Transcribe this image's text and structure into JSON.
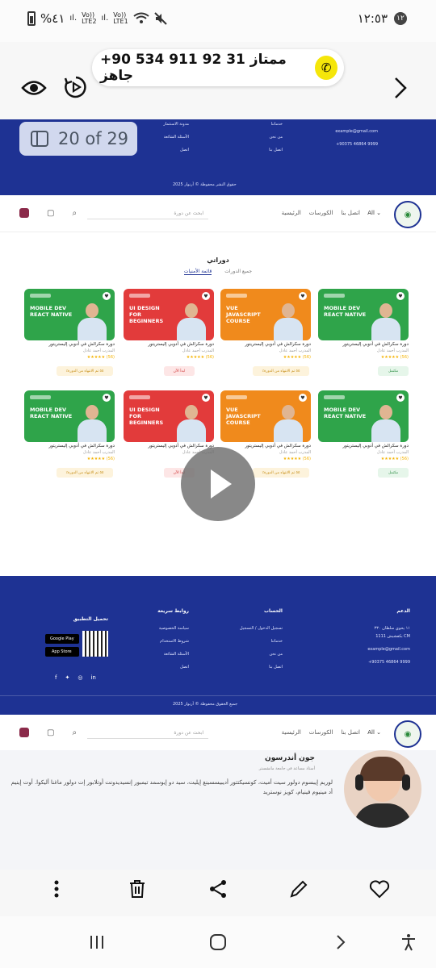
{
  "status_bar": {
    "battery": "%٤١",
    "net1": "Vo))\nLTE2",
    "net2": "Vo))\nLTE1",
    "time": "١٢:٥٣",
    "notif_count": "١٢"
  },
  "viewer": {
    "contact_text": "+90 534 911 92 31 ممتاز جاهز",
    "page_counter": "20 of 29"
  },
  "site": {
    "nav": {
      "home": "الرئيسية",
      "courses": "الكورسات",
      "contact": "اتصل بنا",
      "lang": "All",
      "search_placeholder": "ابحث عن دورة"
    },
    "section_title": "دوراتي",
    "tabs": [
      "قائمة الأمنيات",
      "جميع الدورات"
    ],
    "cards": [
      {
        "thumb_title": "MOBILE DEV\nREACT NATIVE",
        "color": "#2fa44a",
        "title": "دورة سكرالش في أدوبي إليستريتور",
        "sub": "المدرب أحمد عادل",
        "stars": "★★★★★ (56)",
        "button": "مكتمل",
        "btn_bg": "#e6f6ea",
        "btn_fg": "#2f8f47"
      },
      {
        "thumb_title": "VUE JAVASCRIPT\nCOURSE",
        "color": "#f08a1c",
        "title": "دورة سكرالش في أدوبي إليستريتور",
        "sub": "المدرب أحمد عادل",
        "stars": "★★★★★ (56)",
        "button": "٪٥٥ تم الانتهاء من الدورة",
        "btn_bg": "#fdf3dc",
        "btn_fg": "#c48a10"
      },
      {
        "thumb_title": "UI DESIGN\nFOR BEGINNERS",
        "color": "#e23b3b",
        "title": "دورة سكرالش في أدوبي إليستريتور",
        "sub": "المدرب أحمد عادل",
        "stars": "★★★★★ (56)",
        "button": "ابدأ الآن",
        "btn_bg": "#fde6e6",
        "btn_fg": "#d03434"
      },
      {
        "thumb_title": "MOBILE DEV\nREACT NATIVE",
        "color": "#2fa44a",
        "title": "دورة سكرالش في أدوبي إليستريتور",
        "sub": "المدرب أحمد عادل",
        "stars": "★★★★★ (56)",
        "button": "٪٥٥ تم الانتهاء من الدورة",
        "btn_bg": "#fdf3dc",
        "btn_fg": "#c48a10"
      },
      {
        "thumb_title": "MOBILE DEV\nREACT NATIVE",
        "color": "#2fa44a",
        "title": "دورة سكرالش في أدوبي إليستريتور",
        "sub": "المدرب أحمد عادل",
        "stars": "★★★★★ (56)",
        "button": "مكتمل",
        "btn_bg": "#e6f6ea",
        "btn_fg": "#2f8f47"
      },
      {
        "thumb_title": "VUE JAVASCRIPT\nCOURSE",
        "color": "#f08a1c",
        "title": "دورة سكرالش في أدوبي إليستريتور",
        "sub": "المدرب أحمد عادل",
        "stars": "★★★★★ (56)",
        "button": "٪٥٥ تم الانتهاء من الدورة",
        "btn_bg": "#fdf3dc",
        "btn_fg": "#c48a10"
      },
      {
        "thumb_title": "UI DESIGN\nFOR BEGINNERS",
        "color": "#e23b3b",
        "title": "دورة سكرالش في أدوبي إليستريتور",
        "sub": "المدرب أحمد عادل",
        "stars": "",
        "button": "ابدأ الآن",
        "btn_bg": "#fde6e6",
        "btn_fg": "#d03434"
      },
      {
        "thumb_title": "MOBILE DEV\nREACT NATIVE",
        "color": "#2fa44a",
        "title": "دورة سكرالش في أدوبي إليستريتور",
        "sub": "المدرب أحمد عادل",
        "stars": "★★★★★ (56)",
        "button": "٪٥٥ تم الانتهاء من الدورة",
        "btn_bg": "#fdf3dc",
        "btn_fg": "#c48a10"
      }
    ],
    "footer": {
      "support_h": "الدعم",
      "support_lines": [
        "١١ يحوي سلطان ٣٣٠",
        "بكفشيش 1111 CM",
        "example@gmail.com",
        "+90375 46864 9999"
      ],
      "account_h": "الحساب",
      "account_links": [
        "تسجيل الدخول / التسجيل",
        "خدماتنا",
        "من نحن",
        "اتصل بنا"
      ],
      "quick_h": "روابط سريعة",
      "quick_links": [
        "سياسة الخصوصية",
        "شروط الاستخدام",
        "الأسئلة الشائعة",
        "اتصل"
      ],
      "app_h": "تحميل التطبيق",
      "store1": "Google Play",
      "store2": "App Store",
      "copyright": "جميع الحقوق محفوظة © أرنوار 2025"
    },
    "footer_top": {
      "col_links": [
        "مدونة الاستثمار",
        "الأسئلة الشائعة",
        "اتصل"
      ],
      "col_links2": [
        "خدماتنا",
        "من نحن",
        "اتصل بنا"
      ],
      "email": "example@gmail.com",
      "phone": "+90375 46864 9999",
      "copyright": "حقوق النشر محفوظة © أرنوار 2025"
    },
    "profile": {
      "name": "جون أندرسون",
      "role": "أستاذ مساعد في جامعة مانشستر",
      "bio": "لوريم إيبسوم دولور سيت أميت، كونسيكتتور أديبيسسينغ إيليت، سيد دو إيوسمد تيمبور إنسيديدونت أوتلابور إت دولور ماغنا أليكوا. أوت إينيم أد مينيوم فينيام، كويز نوستريد"
    }
  },
  "colors": {
    "navy": "#1e3293",
    "whatsapp_yellow": "#f5e60a"
  }
}
